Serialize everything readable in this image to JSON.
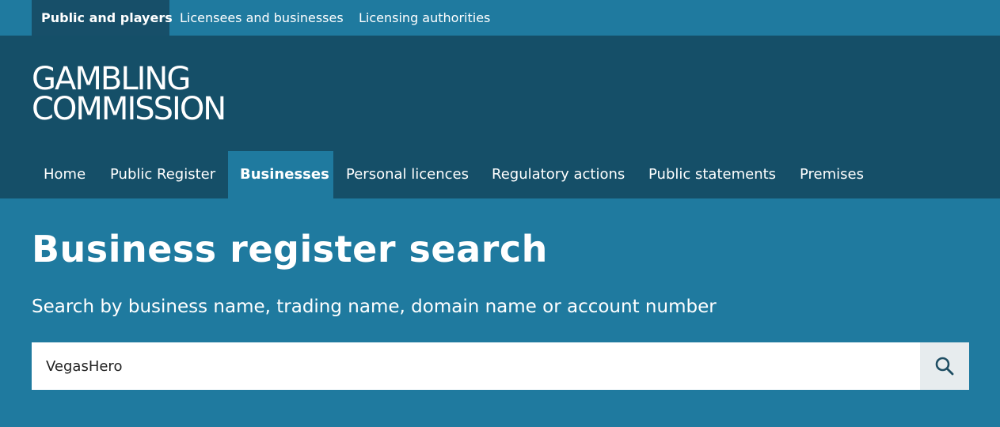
{
  "audience_nav": {
    "items": [
      {
        "label": "Public and players",
        "active": true
      },
      {
        "label": "Licensees and businesses",
        "active": false
      },
      {
        "label": "Licensing authorities",
        "active": false
      }
    ]
  },
  "logo": {
    "line1": "GAMBLING",
    "line2": "COMMISSION"
  },
  "main_nav": {
    "items": [
      {
        "label": "Home",
        "active": false
      },
      {
        "label": "Public Register",
        "active": false
      },
      {
        "label": "Businesses",
        "active": true
      },
      {
        "label": "Personal licences",
        "active": false
      },
      {
        "label": "Regulatory actions",
        "active": false
      },
      {
        "label": "Public statements",
        "active": false
      },
      {
        "label": "Premises",
        "active": false
      }
    ]
  },
  "page": {
    "title": "Business register search",
    "subtitle": "Search by business name, trading name, domain name or account number"
  },
  "search": {
    "value": "VegasHero",
    "button_icon": "search-icon"
  },
  "colors": {
    "light_blue": "#1f7a9f",
    "dark_blue": "#154f68",
    "white": "#ffffff",
    "search_button_bg": "#e7ecee",
    "search_icon": "#1f4e63"
  }
}
